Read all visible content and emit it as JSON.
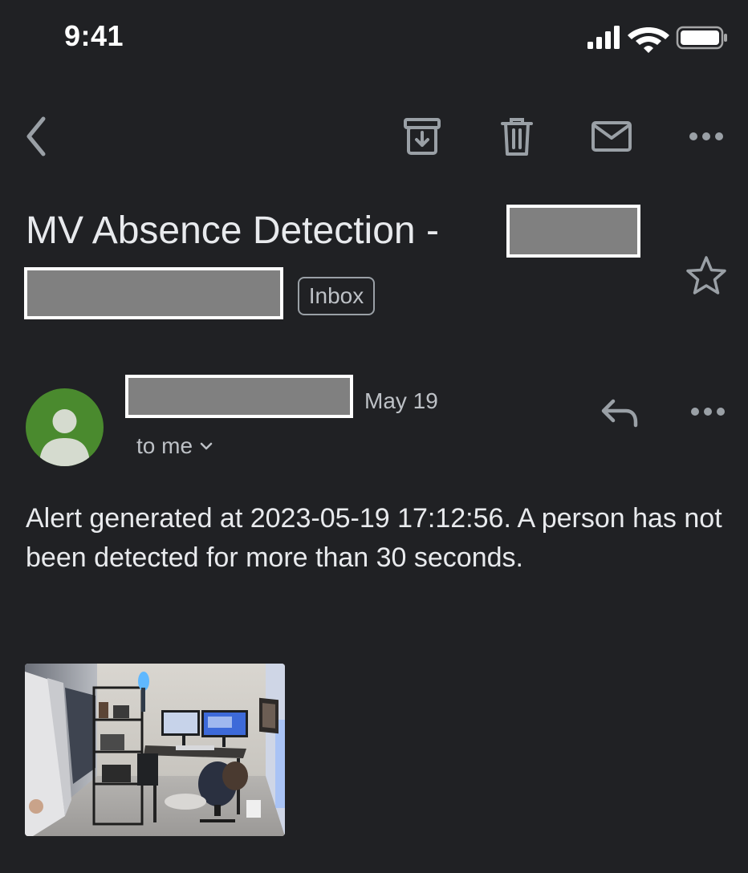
{
  "status_bar": {
    "time": "9:41",
    "icons": [
      "signal-icon",
      "wifi-icon",
      "battery-icon"
    ]
  },
  "toolbar": {
    "icons": [
      "back-arrow-icon",
      "archive-icon",
      "trash-icon",
      "mark-unread-icon",
      "more-icon"
    ]
  },
  "email": {
    "subject": "MV Absence Detection - ",
    "label": "Inbox",
    "date": "May 19",
    "recipient": "to me",
    "body": "Alert generated at 2023-05-19 17:12:56. A person has not been detected for more than 30 seconds."
  },
  "colors": {
    "background": "#202124",
    "text": "#e8eaed",
    "secondary_text": "#bdc1c6",
    "avatar": "#4a8a2e",
    "redaction": "#808080"
  }
}
